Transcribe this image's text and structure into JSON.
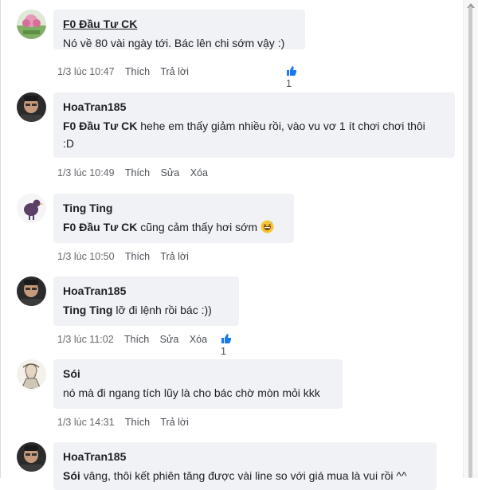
{
  "comments": [
    {
      "author": "F0 Đầu Tư CK",
      "mention": "",
      "text": "Nó về 80 vài ngày tới. Bác lên chi sớm vậy :)",
      "time": "1/3 lúc 10:47",
      "actions": [
        "Thích",
        "Trả lời"
      ],
      "likes": "1"
    },
    {
      "author": "HoaTran185",
      "mention": "F0 Đầu Tư CK",
      "text": " hehe em thấy giảm nhiều rồi, vào vu vơ 1 ít chơi chơi thôi",
      "text2": ":D",
      "time": "1/3 lúc 10:49",
      "actions": [
        "Thích",
        "Sửa",
        "Xóa"
      ],
      "likes": ""
    },
    {
      "author": "Ting Ting",
      "mention": "F0 Đầu Tư CK",
      "text": " cũng cảm thấy hơi sớm ",
      "time": "1/3 lúc 10:50",
      "actions": [
        "Thích",
        "Trả lời"
      ],
      "likes": ""
    },
    {
      "author": "HoaTran185",
      "mention": "Ting Ting",
      "text": " lỡ đi lệnh rồi bác :))",
      "time": "1/3 lúc 11:02",
      "actions": [
        "Thích",
        "Sửa",
        "Xóa"
      ],
      "likes": "1"
    },
    {
      "author": "Sói",
      "mention": "",
      "text": "nó mà đi ngang tích lũy là cho bác chờ mòn mỏi kkk",
      "time": "1/3 lúc 14:31",
      "actions": [
        "Thích",
        "Trả lời"
      ],
      "likes": ""
    },
    {
      "author": "HoaTran185",
      "mention": "Sói",
      "text": " vâng, thôi kết phiên tăng được vài line so với giá mua là vui rồi ^^",
      "time": "",
      "actions": [],
      "likes": ""
    }
  ],
  "colors": {
    "bubble": "#f0f2f5",
    "like_blue": "#1877f2",
    "meta": "#65676b"
  },
  "icons": {
    "like": "thumbs-up-icon",
    "emoji": "grinning-sweat-emoji-icon"
  }
}
